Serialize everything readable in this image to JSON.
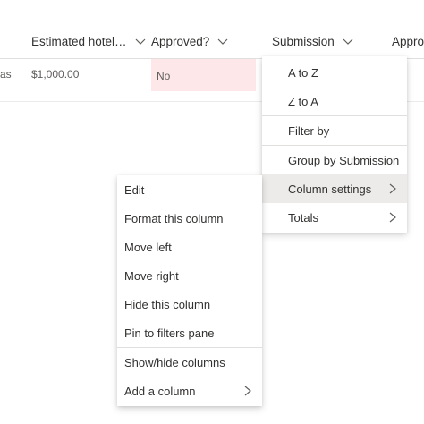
{
  "header": {
    "columns": [
      {
        "label": "Estimated hotel…"
      },
      {
        "label": "Approved?"
      },
      {
        "label": "Submission"
      },
      {
        "label": "Appro"
      }
    ]
  },
  "row": {
    "left_fragment": "as",
    "estimated_hotel": "$1,000.00",
    "approved": "No"
  },
  "submission_menu": {
    "sort_az": "A to Z",
    "sort_za": "Z to A",
    "filter_by": "Filter by",
    "group_by": "Group by Submission",
    "column_settings": "Column settings",
    "totals": "Totals"
  },
  "column_settings_menu": {
    "edit": "Edit",
    "format": "Format this column",
    "move_left": "Move left",
    "move_right": "Move right",
    "hide": "Hide this column",
    "pin": "Pin to filters pane",
    "show_hide": "Show/hide columns",
    "add_column": "Add a column"
  },
  "colors": {
    "approved_no_bg": "#fde7e9",
    "active_item_bg": "#edebe9"
  },
  "icons": {
    "column_dropdown": "chevron-down-icon",
    "submenu": "chevron-right-icon"
  }
}
